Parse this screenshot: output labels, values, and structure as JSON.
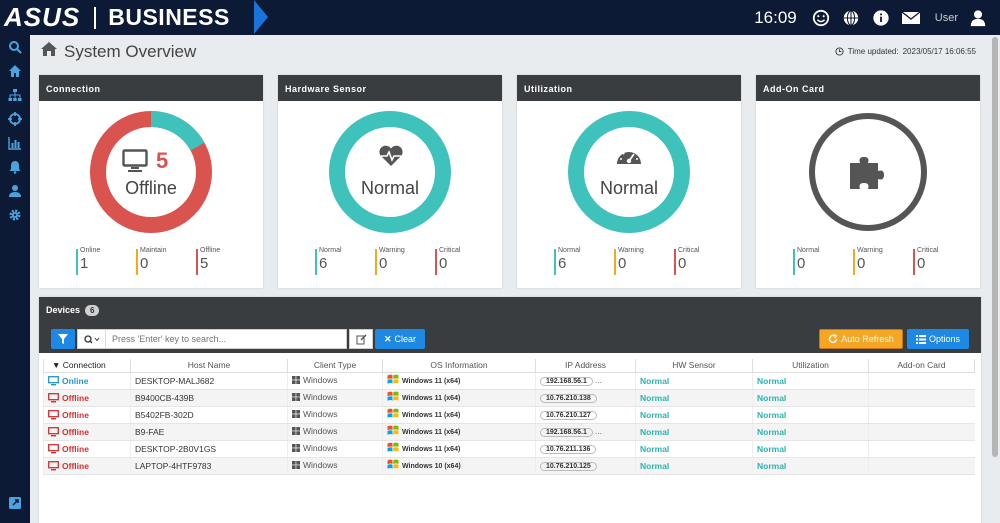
{
  "brand": {
    "logo": "ASUS",
    "product": "BUSINESS"
  },
  "topbar": {
    "time": "16:09",
    "user_label": "User",
    "icons": [
      "smiley-icon",
      "globe-icon",
      "info-icon",
      "mail-icon",
      "user-icon"
    ]
  },
  "rail": {
    "icons": [
      "search-icon",
      "home-icon",
      "sitemap-icon",
      "crosshair-icon",
      "chart-icon",
      "bell-icon",
      "user-icon",
      "gear-icon"
    ],
    "bottom_icon": "export-icon"
  },
  "page": {
    "title": "System Overview",
    "updated_label": "Time updated:",
    "updated_value": "2023/05/17 16:06:55"
  },
  "colors": {
    "normal": "#3fc1bc",
    "warning": "#f5a623",
    "critical": "#d9534f",
    "online": "#3fc1bc",
    "addon_ring": "#555555",
    "accent": "#1e88e5"
  },
  "cards": [
    {
      "title": "Connection",
      "center_value": "5",
      "center_label": "Offline",
      "legend": [
        {
          "label": "Online",
          "value": "1"
        },
        {
          "label": "Maintain",
          "value": "0"
        },
        {
          "label": "Offline",
          "value": "5"
        }
      ],
      "ratio_online": 0.17
    },
    {
      "title": "Hardware Sensor",
      "center_label": "Normal",
      "legend": [
        {
          "label": "Normal",
          "value": "6"
        },
        {
          "label": "Warning",
          "value": "0"
        },
        {
          "label": "Critical",
          "value": "0"
        }
      ]
    },
    {
      "title": "Utilization",
      "center_label": "Normal",
      "legend": [
        {
          "label": "Normal",
          "value": "6"
        },
        {
          "label": "Warning",
          "value": "0"
        },
        {
          "label": "Critical",
          "value": "0"
        }
      ]
    },
    {
      "title": "Add-On Card",
      "legend": [
        {
          "label": "Normal",
          "value": "0"
        },
        {
          "label": "Warning",
          "value": "0"
        },
        {
          "label": "Critical",
          "value": "0"
        }
      ]
    }
  ],
  "devices": {
    "title": "Devices",
    "count": "6",
    "search_placeholder": "Press 'Enter' key to search...",
    "clear_label": "Clear",
    "auto_refresh_label": "Auto Refresh",
    "options_label": "Options",
    "columns": [
      "Connection",
      "Host Name",
      "Client Type",
      "OS Information",
      "IP Address",
      "HW Sensor",
      "Utilization",
      "Add-on Card"
    ],
    "rows": [
      {
        "connection": "Online",
        "host": "DESKTOP-MALJ682",
        "client": "Windows",
        "os": "Windows 11 (x64)",
        "ip": "192.168.56.1",
        "ip_more": "...",
        "hw": "Normal",
        "util": "Normal",
        "addon": ""
      },
      {
        "connection": "Offline",
        "host": "B9400CB-439B",
        "client": "Windows",
        "os": "Windows 11 (x64)",
        "ip": "10.76.210.138",
        "ip_more": "",
        "hw": "Normal",
        "util": "Normal",
        "addon": ""
      },
      {
        "connection": "Offline",
        "host": "B5402FB-302D",
        "client": "Windows",
        "os": "Windows 11 (x64)",
        "ip": "10.76.210.127",
        "ip_more": "",
        "hw": "Normal",
        "util": "Normal",
        "addon": ""
      },
      {
        "connection": "Offline",
        "host": "B9-FAE",
        "client": "Windows",
        "os": "Windows 11 (x64)",
        "ip": "192.168.56.1",
        "ip_more": "...",
        "hw": "Normal",
        "util": "Normal",
        "addon": ""
      },
      {
        "connection": "Offline",
        "host": "DESKTOP-2B0V1GS",
        "client": "Windows",
        "os": "Windows 11 (x64)",
        "ip": "10.76.211.136",
        "ip_more": "",
        "hw": "Normal",
        "util": "Normal",
        "addon": ""
      },
      {
        "connection": "Offline",
        "host": "LAPTOP-4HTF9783",
        "client": "Windows",
        "os": "Windows 10 (x64)",
        "ip": "10.76.210.125",
        "ip_more": "",
        "hw": "Normal",
        "util": "Normal",
        "addon": ""
      }
    ]
  }
}
